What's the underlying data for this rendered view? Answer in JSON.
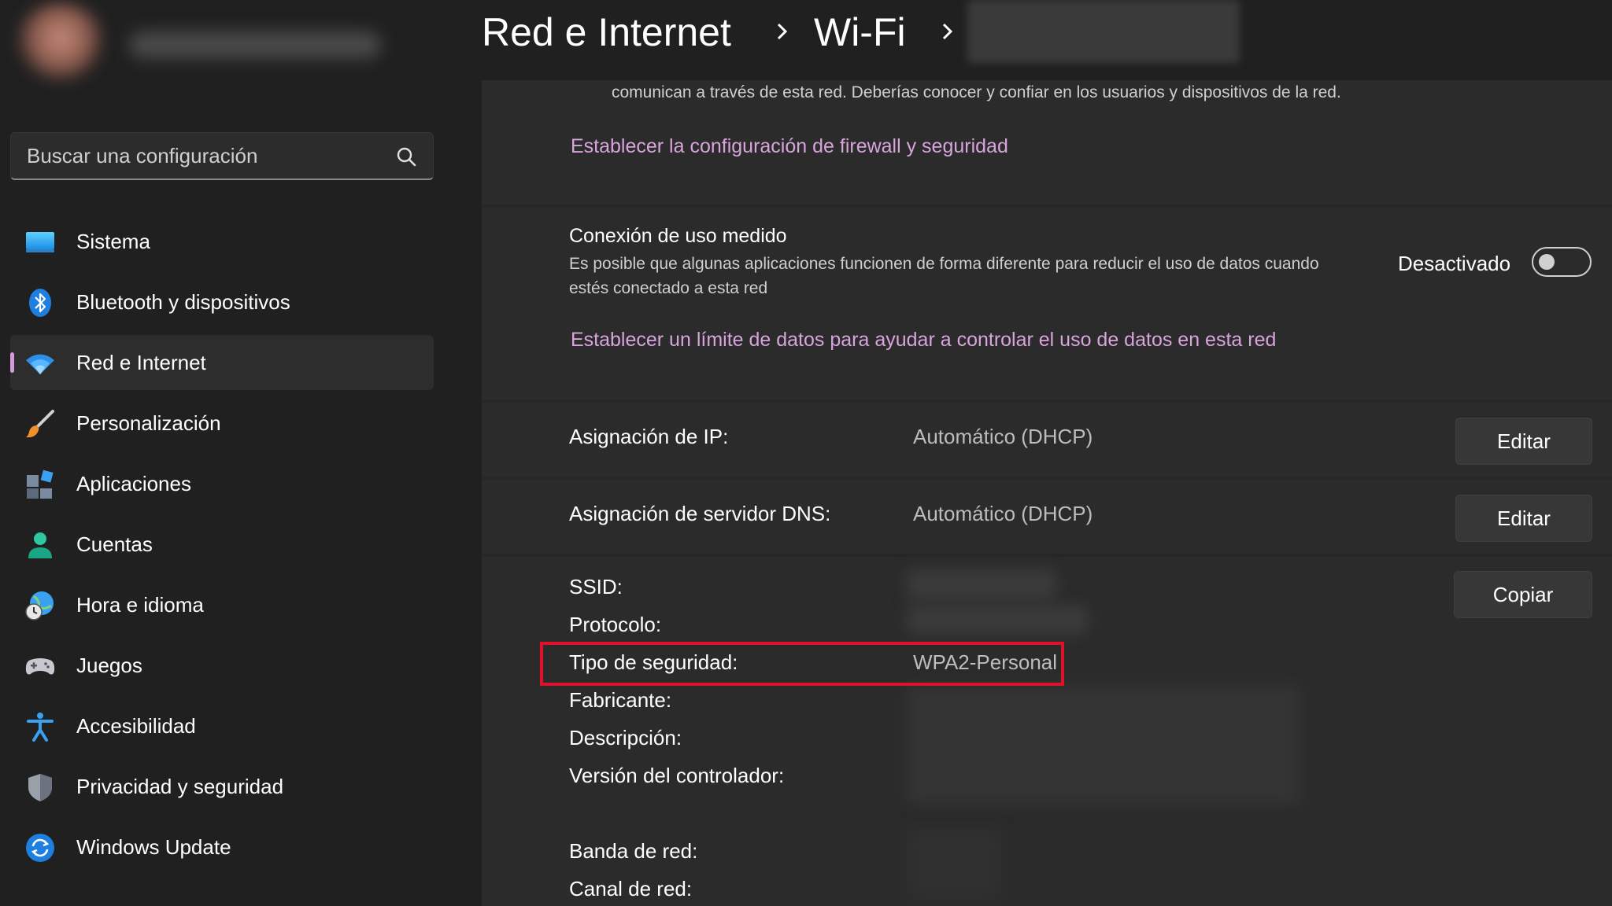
{
  "sidebar": {
    "search": {
      "placeholder": "Buscar una configuración"
    },
    "items": [
      {
        "label": "Sistema",
        "icon": "system-icon"
      },
      {
        "label": "Bluetooth y dispositivos",
        "icon": "bluetooth-icon"
      },
      {
        "label": "Red e Internet",
        "icon": "wifi-icon",
        "active": true
      },
      {
        "label": "Personalización",
        "icon": "brush-icon"
      },
      {
        "label": "Aplicaciones",
        "icon": "apps-icon"
      },
      {
        "label": "Cuentas",
        "icon": "account-icon"
      },
      {
        "label": "Hora e idioma",
        "icon": "time-language-icon"
      },
      {
        "label": "Juegos",
        "icon": "gamepad-icon"
      },
      {
        "label": "Accesibilidad",
        "icon": "accessibility-icon"
      },
      {
        "label": "Privacidad y seguridad",
        "icon": "shield-icon"
      },
      {
        "label": "Windows Update",
        "icon": "update-icon"
      }
    ]
  },
  "header": {
    "breadcrumb": [
      "Red e Internet",
      "Wi-Fi"
    ]
  },
  "firewall": {
    "description": "comunican a través de esta red. Deberías conocer y confiar en los usuarios y dispositivos de la red.",
    "link": "Establecer la configuración de firewall y seguridad"
  },
  "metered": {
    "title": "Conexión de uso medido",
    "description": "Es posible que algunas aplicaciones funcionen de forma diferente para reducir el uso de datos cuando estés conectado a esta red",
    "toggle_label": "Desactivado",
    "toggle_on": false,
    "link": "Establecer un límite de datos para ayudar a controlar el uso de datos en esta red"
  },
  "ip": {
    "label": "Asignación de IP:",
    "value": "Automático (DHCP)",
    "button": "Editar"
  },
  "dns": {
    "label": "Asignación de servidor DNS:",
    "value": "Automático (DHCP)",
    "button": "Editar"
  },
  "properties": {
    "copy_button": "Copiar",
    "rows": [
      {
        "label": "SSID:",
        "value": ""
      },
      {
        "label": "Protocolo:",
        "value": ""
      },
      {
        "label": "Tipo de seguridad:",
        "value": "WPA2-Personal"
      },
      {
        "label": "Fabricante:",
        "value": ""
      },
      {
        "label": "Descripción:",
        "value": ""
      },
      {
        "label": "Versión del controlador:",
        "value": ""
      },
      {
        "label": "Banda de red:",
        "value": ""
      },
      {
        "label": "Canal de red:",
        "value": ""
      }
    ]
  },
  "colors": {
    "accent": "#d59bd9",
    "link": "#d8a4dc",
    "highlight": "#e3102c"
  }
}
